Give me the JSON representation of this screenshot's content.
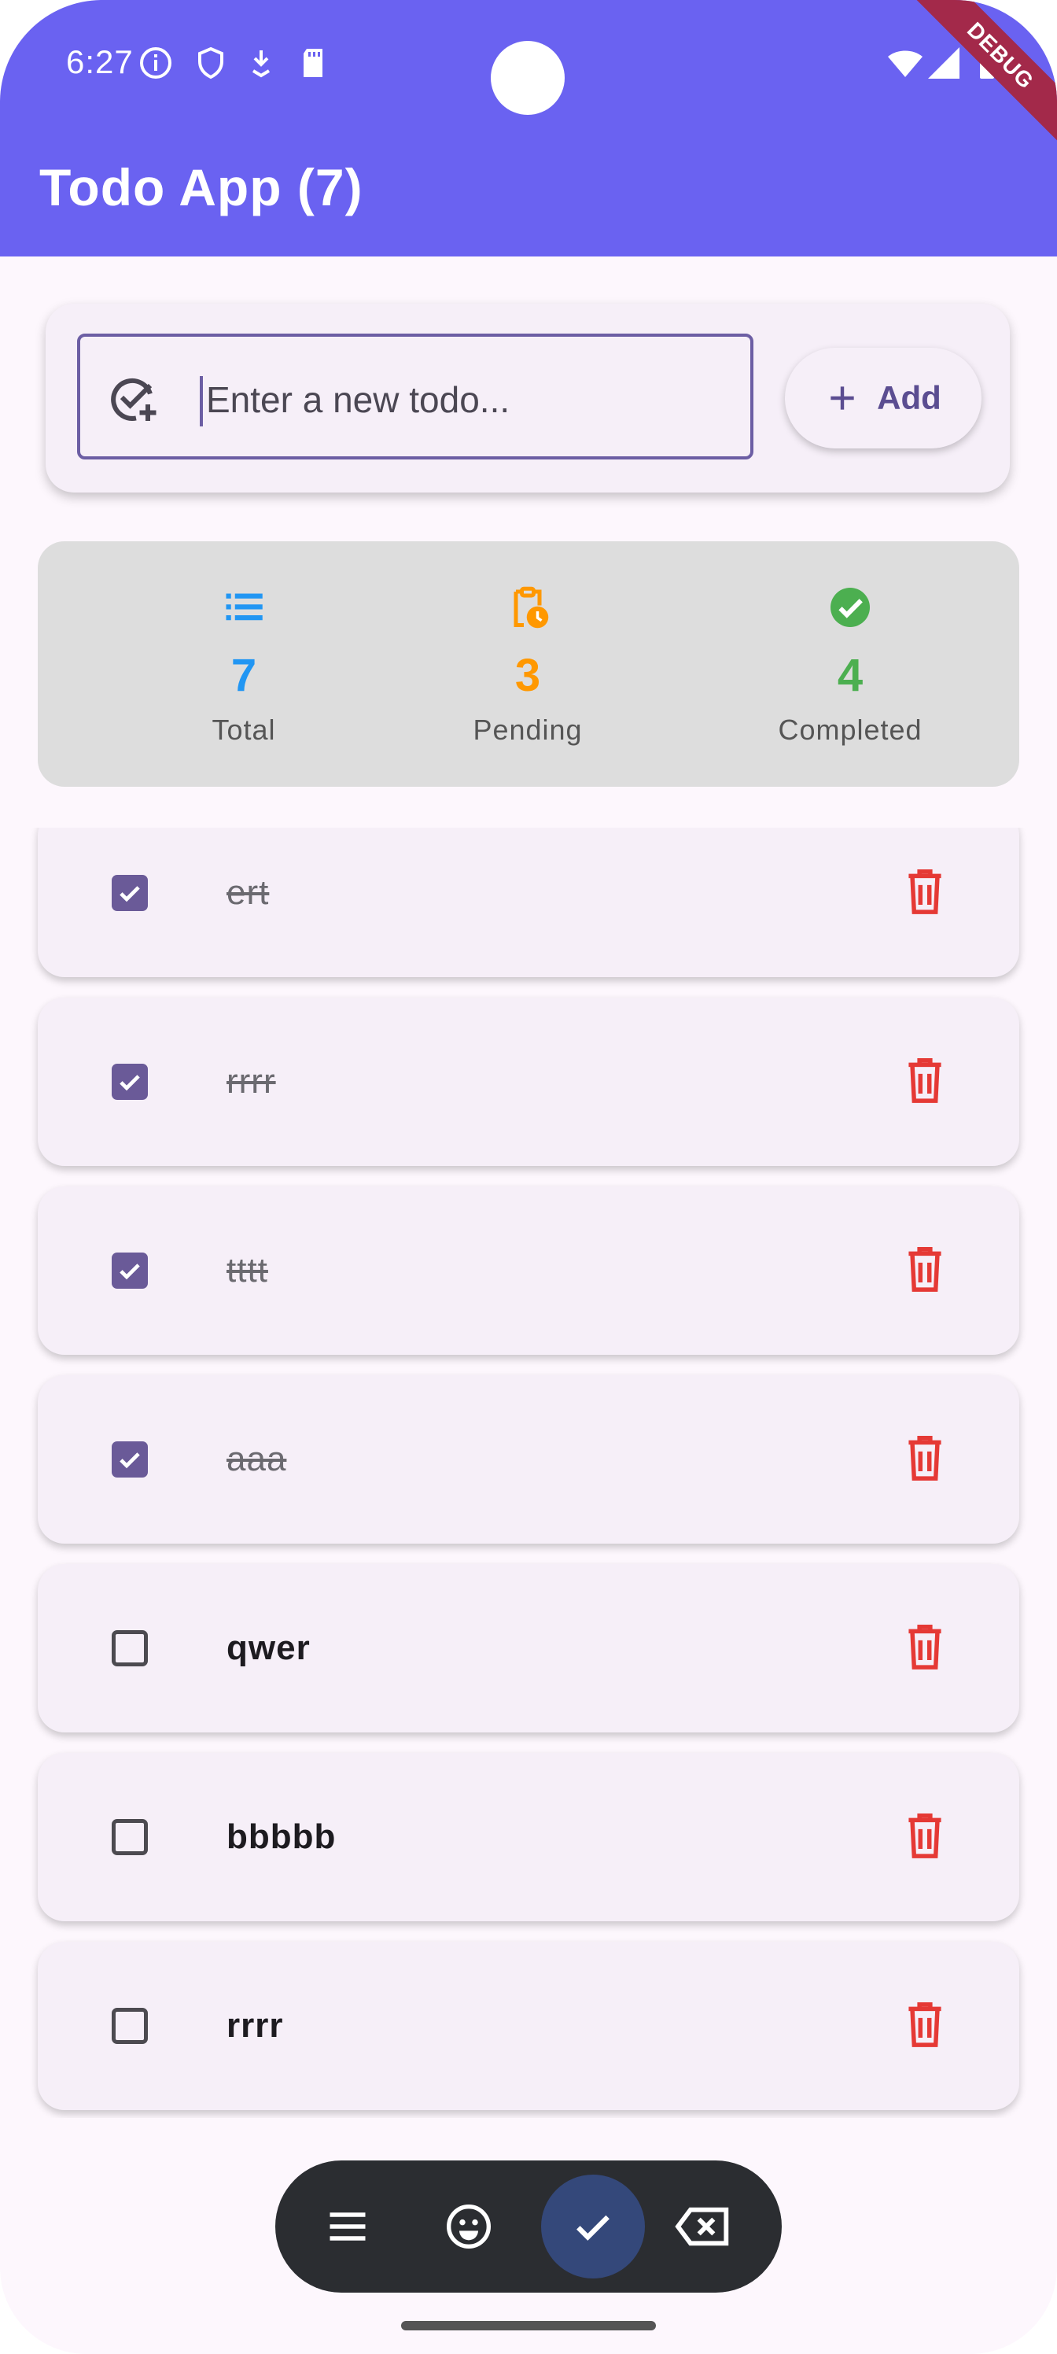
{
  "status_bar": {
    "time": "6:27",
    "debug_label": "DEBUG"
  },
  "app_bar": {
    "title": "Todo App (7)"
  },
  "new_todo": {
    "placeholder": "Enter a new todo...",
    "add_label": "Add"
  },
  "stats": [
    {
      "value": "7",
      "label": "Total",
      "icon": "list-icon",
      "color": "#2196f3"
    },
    {
      "value": "3",
      "label": "Pending",
      "icon": "pending-clipboard-icon",
      "color": "#ff9800"
    },
    {
      "value": "4",
      "label": "Completed",
      "icon": "check-circle-icon",
      "color": "#4caf50"
    }
  ],
  "todos": [
    {
      "text": "ert",
      "completed": true
    },
    {
      "text": "rrrr",
      "completed": true
    },
    {
      "text": "tttt",
      "completed": true
    },
    {
      "text": "aaa",
      "completed": true
    },
    {
      "text": "qwer",
      "completed": false
    },
    {
      "text": "bbbbb",
      "completed": false
    },
    {
      "text": "rrrr",
      "completed": false
    }
  ],
  "keyboard_toolbar": {
    "buttons": [
      "menu-icon",
      "emoji-icon",
      "checkmark-icon",
      "backspace-icon"
    ]
  },
  "colors": {
    "primary": "#6a62f1",
    "checkbox": "#6a5a98",
    "delete": "#e53935"
  }
}
